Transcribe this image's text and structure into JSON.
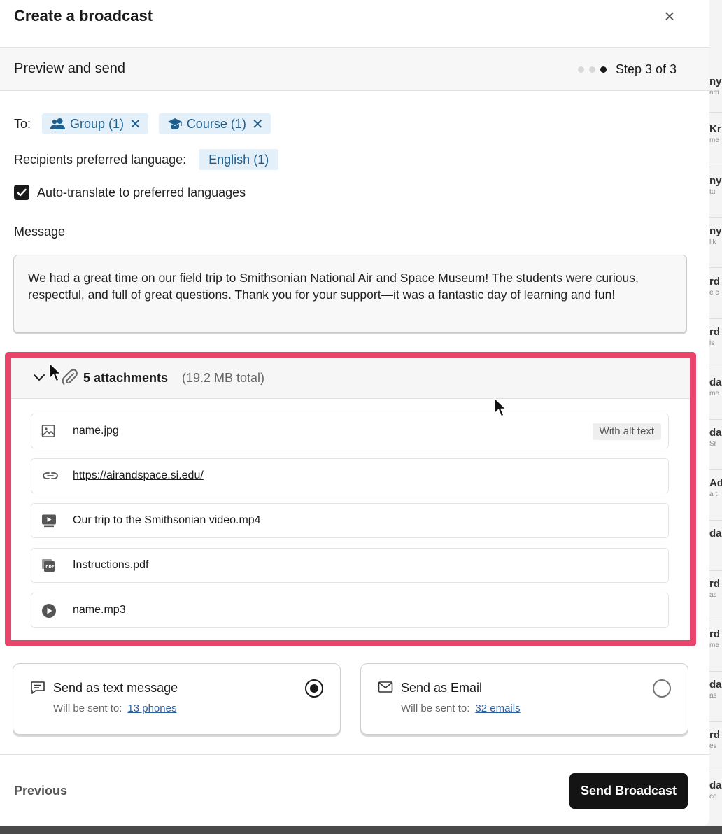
{
  "modal": {
    "title": "Create a broadcast",
    "close_glyph": "×"
  },
  "step": {
    "title": "Preview and send",
    "label": "Step 3 of 3",
    "total": 3,
    "current": 3
  },
  "recipients": {
    "to_label": "To:",
    "chips": [
      {
        "icon": "group-icon",
        "label": "Group (1)"
      },
      {
        "icon": "graduation-cap-icon",
        "label": "Course (1)"
      }
    ],
    "language_label": "Recipients preferred language:",
    "language_chip": "English (1)"
  },
  "auto_translate": {
    "label": "Auto-translate to preferred languages",
    "checked": true
  },
  "message": {
    "label": "Message",
    "text": "We had a great time on our field trip to Smithsonian National Air and Space Museum! The students were curious, respectful, and full of great questions. Thank you for your support—it was a fantastic day of learning and fun!"
  },
  "attachments": {
    "count_label": "5 attachments",
    "size_label": "(19.2 MB total)",
    "items": [
      {
        "icon": "image-icon",
        "name": "name.jpg",
        "badge": "With alt text",
        "is_link": false
      },
      {
        "icon": "link-icon",
        "name": "https://airandspace.si.edu/",
        "badge": "",
        "is_link": true
      },
      {
        "icon": "video-icon",
        "name": "Our trip to the Smithsonian video.mp4",
        "badge": "",
        "is_link": false
      },
      {
        "icon": "pdf-icon",
        "name": "Instructions.pdf",
        "badge": "",
        "is_link": false
      },
      {
        "icon": "audio-play-icon",
        "name": "name.mp3",
        "badge": "",
        "is_link": false
      }
    ]
  },
  "send_options": [
    {
      "icon": "chat-message-icon",
      "title": "Send as text message",
      "sub_label": "Will be sent to:",
      "link": "13 phones",
      "selected": true
    },
    {
      "icon": "envelope-icon",
      "title": "Send as Email",
      "sub_label": "Will be sent to:",
      "link": "32 emails",
      "selected": false
    }
  ],
  "footer": {
    "previous_label": "Previous",
    "send_label": "Send Broadcast"
  },
  "colors": {
    "highlight_border": "#e8446c",
    "chip_bg": "#e4f0f9",
    "chip_text": "#1f5f8d",
    "link": "#2c5f9e",
    "primary_button": "#141414"
  }
}
